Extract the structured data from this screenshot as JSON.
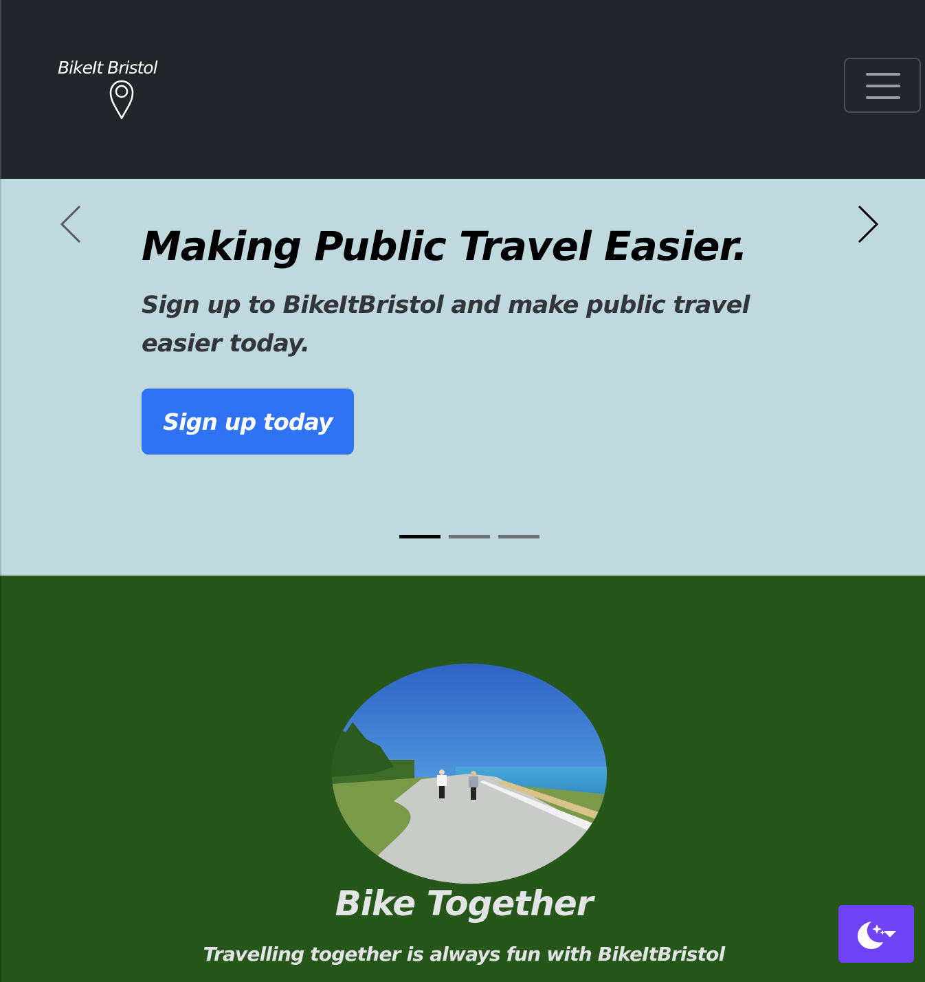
{
  "navbar": {
    "brand_text": "BikeIt Bristol",
    "brand_icon": "map-pin-icon",
    "toggler_icon": "hamburger-icon"
  },
  "carousel": {
    "prev_icon": "chevron-left-icon",
    "next_icon": "chevron-right-icon",
    "title": "Making Public Travel Easier.",
    "subtitle": "Sign up to BikeItBristol and make public travel easier today.",
    "cta_label": "Sign up today",
    "indicators": [
      {
        "active": true
      },
      {
        "active": false
      },
      {
        "active": false
      }
    ]
  },
  "feature": {
    "title": "Bike Together",
    "text": "Travelling together is always fun with BikeItBristol"
  },
  "theme_toggle": {
    "icon": "moon-stars-icon",
    "caret_icon": "caret-down-icon"
  },
  "colors": {
    "navbar_bg": "#22252a",
    "carousel_bg": "#bfd9de",
    "feature_bg": "#26561a",
    "primary_button": "#2f72f4",
    "theme_button": "#6f42f5"
  }
}
